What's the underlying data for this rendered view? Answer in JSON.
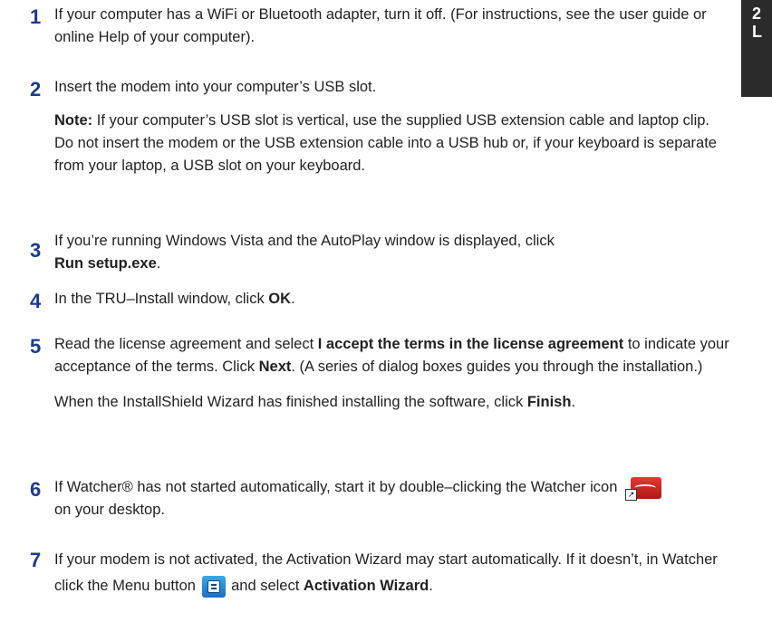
{
  "side_tab": {
    "line1": "2",
    "line2": "L"
  },
  "steps": [
    {
      "number": "1",
      "text": "If your computer has a WiFi or Bluetooth adapter, turn it off. (For instructions, see the user guide or online Help of your computer)."
    },
    {
      "number": "2",
      "text": "Insert the modem into your computer’s USB slot.",
      "note_label": "Note:",
      "note_text": " If your computer’s USB slot is vertical, use the supplied USB extension cable and laptop clip.",
      "note_text2": "Do not insert the modem or the USB extension cable into a USB hub or, if your keyboard is separate from your laptop, a USB slot on your keyboard."
    },
    {
      "number": "3",
      "text_before": "If you’re running Windows Vista and the AutoPlay window is displayed, click ",
      "bold": "Run setup.exe",
      "text_after": "."
    },
    {
      "number": "4",
      "text_before": "In the TRU–Install window, click ",
      "bold": "OK",
      "text_after": "."
    },
    {
      "number": "5",
      "t1": "Read the license agreement and select ",
      "b1": "I accept the terms in the license agreement",
      "t2": " to indicate your acceptance of the terms. Click ",
      "b2": "Next",
      "t3": ". (A series of dialog boxes guides you through the installation.)",
      "p2_before": "When the InstallShield Wizard has finished installing the software, click ",
      "p2_bold": "Finish",
      "p2_after": "."
    },
    {
      "number": "6",
      "text_before": "If Watcher® has not started automatically, start it by double–clicking the Watcher icon ",
      "text_after": " on your desktop.",
      "icon": "watcher-app-icon"
    },
    {
      "number": "7",
      "text_before": "If your modem is not activated, the Activation Wizard may start automatically. If it doesn’t, in Watcher click the Menu button ",
      "text_mid": " and select ",
      "bold": "Activation Wizard",
      "text_after": ".",
      "icon": "menu-button-icon"
    }
  ],
  "colors": {
    "step_number": "#1e3a8c",
    "text": "#231f20",
    "tab_bg": "#2b2b2b"
  }
}
